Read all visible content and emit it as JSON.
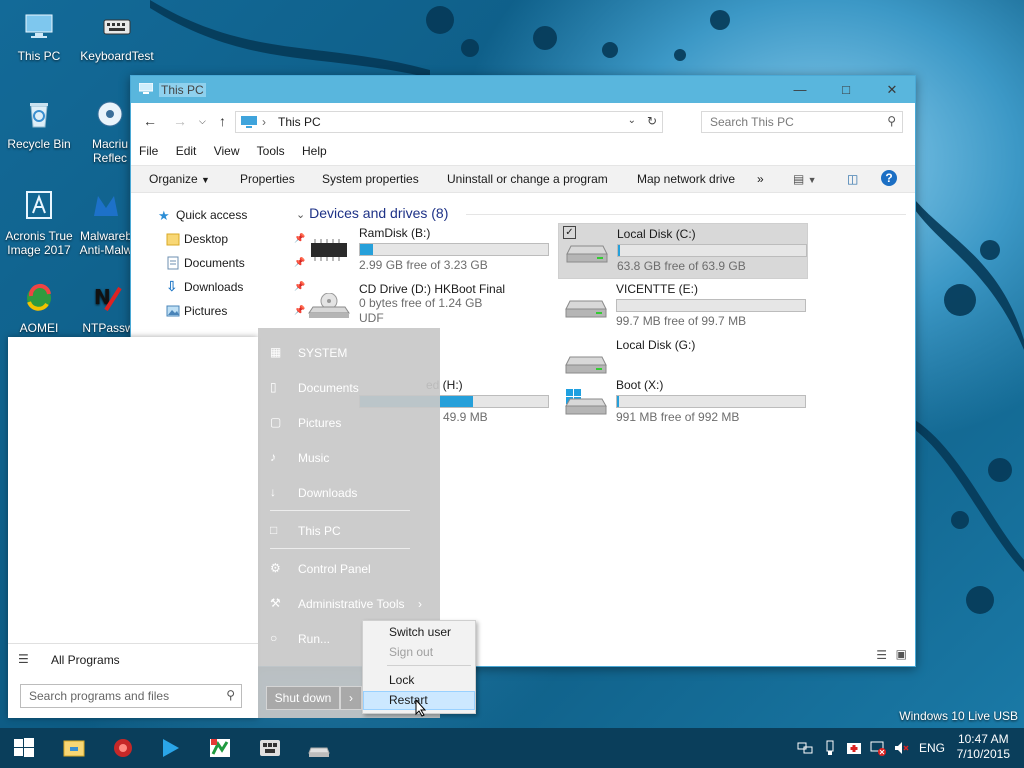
{
  "desktop": {
    "icons": [
      {
        "label": "This PC",
        "icon": "computer-icon"
      },
      {
        "label": "KeyboardTest",
        "icon": "keyboard-icon"
      },
      {
        "label": "Recycle Bin",
        "icon": "recycle-bin-icon"
      },
      {
        "label": "Macriu\nReflec",
        "icon": "macrium-icon"
      },
      {
        "label": "Acronis True\nImage 2017",
        "icon": "acronis-icon"
      },
      {
        "label": "Malwareb\nAnti-Malw",
        "icon": "malwarebytes-icon"
      },
      {
        "label": "AOMEI",
        "icon": "aomei-icon"
      },
      {
        "label": "NTPassw",
        "icon": "ntpasswd-icon"
      }
    ]
  },
  "explorer": {
    "title": "This PC",
    "address": "This PC",
    "search_placeholder": "Search This PC",
    "menu": [
      "File",
      "Edit",
      "View",
      "Tools",
      "Help"
    ],
    "commands": [
      "Organize",
      "Properties",
      "System properties",
      "Uninstall or change a program",
      "Map network drive",
      "»"
    ],
    "nav": [
      {
        "label": "Quick access",
        "icon": "star-icon"
      },
      {
        "label": "Desktop",
        "icon": "folder-icon"
      },
      {
        "label": "Documents",
        "icon": "document-icon"
      },
      {
        "label": "Downloads",
        "icon": "download-arrow-icon"
      },
      {
        "label": "Pictures",
        "icon": "pictures-icon"
      }
    ],
    "group_header": "Devices and drives (8)",
    "drives": [
      {
        "name": "RamDisk (B:)",
        "free": "2.99 GB free of 3.23 GB",
        "used_pct": 7,
        "icon": "ram-chip-icon"
      },
      {
        "name": "Local Disk (C:)",
        "free": "63.8 GB free of 63.9 GB",
        "used_pct": 1,
        "icon": "hard-drive-icon",
        "selected": true
      },
      {
        "name": "CD Drive (D:) HKBoot Final",
        "free": "0 bytes free of 1.24 GB",
        "fs": "UDF",
        "used_pct": 100,
        "icon": "cd-drive-icon"
      },
      {
        "name": "VICENTTE (E:)",
        "free": "99.7 MB free of 99.7 MB",
        "used_pct": 0,
        "icon": "hard-drive-icon"
      },
      {
        "name": "Local Disk (G:)",
        "icon": "hard-drive-icon"
      },
      {
        "name": "ed (H:)",
        "free": "49.9 MB",
        "used_pct": 60,
        "icon": "hard-drive-icon"
      },
      {
        "name": "Boot (X:)",
        "free": "991 MB free of 992 MB",
        "used_pct": 1,
        "icon": "windows-drive-icon"
      }
    ]
  },
  "start_menu": {
    "all_programs": "All Programs",
    "search_placeholder": "Search programs and files",
    "right_items": [
      {
        "label": "SYSTEM",
        "icon": "user-folder-icon"
      },
      {
        "label": "Documents",
        "icon": "documents-library-icon"
      },
      {
        "label": "Pictures",
        "icon": "pictures-icon"
      },
      {
        "label": "Music",
        "icon": "music-note-icon"
      },
      {
        "label": "Downloads",
        "icon": "download-arrow-icon"
      },
      {
        "label": "This PC",
        "icon": "computer-icon"
      },
      {
        "label": "Control Panel",
        "icon": "control-panel-icon"
      },
      {
        "label": "Administrative Tools",
        "icon": "admin-tools-icon"
      },
      {
        "label": "Run...",
        "icon": "run-icon"
      }
    ],
    "shutdown_label": "Shut down",
    "context_menu": [
      "Switch user",
      "Sign out",
      "Lock",
      "Restart"
    ]
  },
  "taskbar": {
    "lang": "ENG",
    "time": "10:47 AM",
    "date": "7/10/2015",
    "watermark": "Windows 10 Live USB"
  }
}
